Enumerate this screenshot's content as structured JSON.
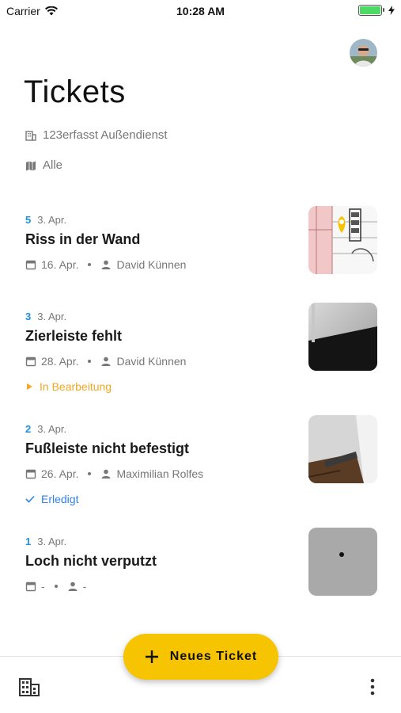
{
  "status_bar": {
    "carrier": "Carrier",
    "time": "10:28 AM",
    "battery_level": 1.0
  },
  "header": {
    "title": "Tickets",
    "company": "123erfasst Außendienst",
    "filter": "Alle",
    "avatar_icon": "user-avatar"
  },
  "tickets": [
    {
      "number": "5",
      "created": "3. Apr.",
      "title": "Riss in der Wand",
      "due": "16. Apr.",
      "assignee": "David Künnen",
      "status": "",
      "thumb_icon": "map-plan-with-pin"
    },
    {
      "number": "3",
      "created": "3. Apr.",
      "title": "Zierleiste fehlt",
      "due": "28. Apr.",
      "assignee": "David Künnen",
      "status": "In Bearbeitung",
      "status_color": "#f5a623",
      "thumb_icon": "photo-wall-edge"
    },
    {
      "number": "2",
      "created": "3. Apr.",
      "title": "Fußleiste nicht befestigt",
      "due": "26. Apr.",
      "assignee": "Maximilian Rolfes",
      "status": "Erledigt",
      "status_color": "#2f80ed",
      "thumb_icon": "photo-baseboard"
    },
    {
      "number": "1",
      "created": "3. Apr.",
      "title": "Loch nicht verputzt",
      "due": "-",
      "assignee": "-",
      "status": "",
      "thumb_icon": "photo-hole-in-wall"
    }
  ],
  "fab": {
    "label": "Neues Ticket",
    "icon": "plus-icon",
    "color": "#f6c400"
  },
  "bottom_bar": {
    "left_icon": "building-icon",
    "right_icon": "more-vertical-icon"
  },
  "colors": {
    "accent_blue": "#1e8fe0",
    "in_progress": "#f5a623",
    "done": "#2f80ed"
  }
}
